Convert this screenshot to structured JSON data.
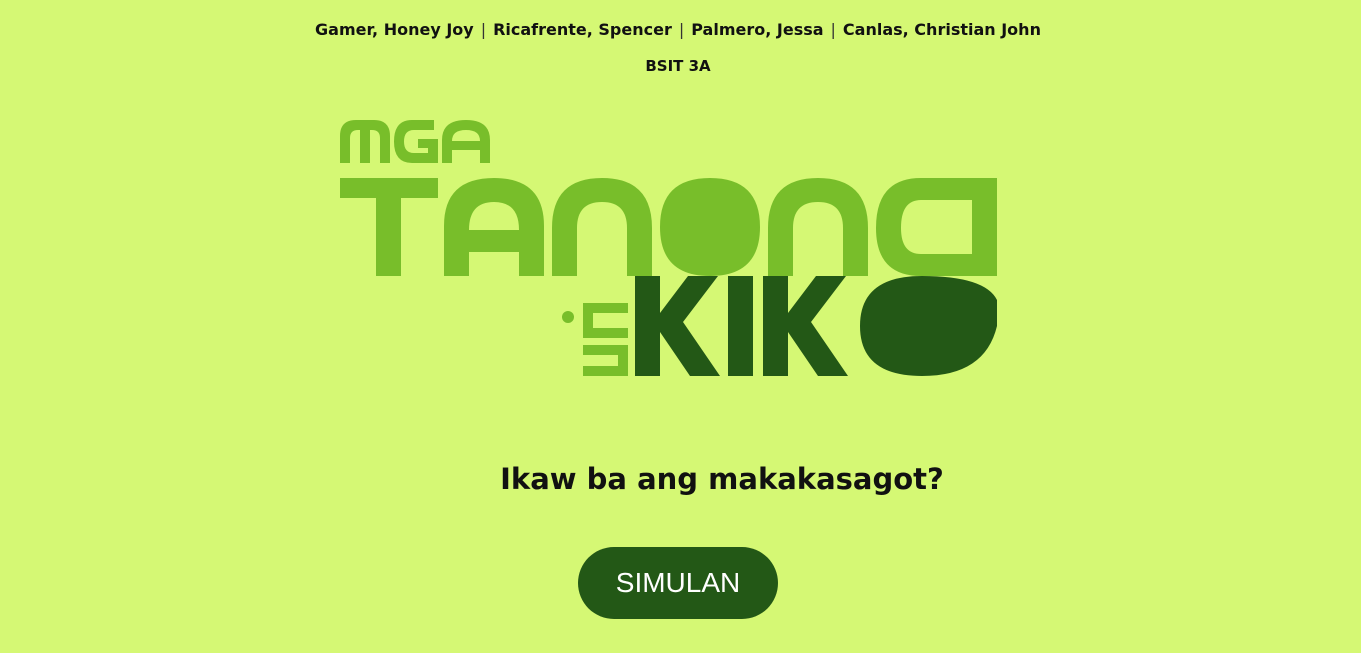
{
  "header": {
    "authors": [
      "Gamer, Honey Joy",
      "Ricafrente, Spencer",
      "Palmero, Jessa",
      "Canlas, Christian John"
    ],
    "separator": "|",
    "section": "BSIT 3A"
  },
  "logo": {
    "line1": "MGA",
    "line2": "TANONG",
    "connector": "ni",
    "line3": "KIKO",
    "colors": {
      "light_green": "#78be2a",
      "dark_green": "#235816"
    }
  },
  "main": {
    "tagline": "Ikaw ba ang makakasagot?",
    "start_label": "SIMULAN"
  },
  "theme": {
    "background": "#d5f874",
    "button": "#235816"
  }
}
